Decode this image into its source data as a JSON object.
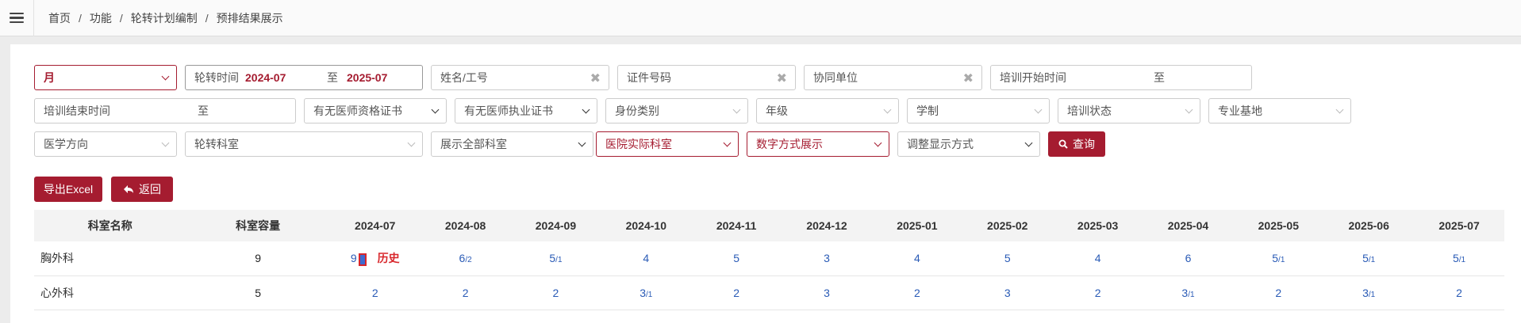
{
  "breadcrumb": [
    "首页",
    "功能",
    "轮转计划编制",
    "预排结果展示"
  ],
  "filters": {
    "period": "月",
    "rotation_time_label": "轮转时间",
    "rotation_start": "2024-07",
    "rotation_to": "至",
    "rotation_end": "2025-07",
    "name_placeholder": "姓名/工号",
    "id_placeholder": "证件号码",
    "coop_placeholder": "协同单位",
    "train_start_label": "培训开始时间",
    "train_start_to": "至",
    "train_end_label": "培训结束时间",
    "train_end_to": "至",
    "doctor_qual": "有无医师资格证书",
    "doctor_license": "有无医师执业证书",
    "identity": "身份类别",
    "grade": "年级",
    "schooling": "学制",
    "train_status": "培训状态",
    "base": "专业基地",
    "direction": "医学方向",
    "rotation_dept": "轮转科室",
    "show_all": "展示全部科室",
    "actual_dept": "医院实际科室",
    "display_mode": "数字方式展示",
    "adjust_mode": "调整显示方式",
    "query": "查询"
  },
  "actions": {
    "export": "导出Excel",
    "back": "返回"
  },
  "table": {
    "headers": [
      "科室名称",
      "科室容量",
      "2024-07",
      "2024-08",
      "2024-09",
      "2024-10",
      "2024-11",
      "2024-12",
      "2025-01",
      "2025-02",
      "2025-03",
      "2025-04",
      "2025-05",
      "2025-06",
      "2025-07"
    ],
    "rows": [
      {
        "name": "胸外科",
        "capacity": "9",
        "cells": [
          {
            "main": "9",
            "sub": ""
          },
          {
            "main": "6",
            "sub": "/2"
          },
          {
            "main": "5",
            "sub": "/1"
          },
          {
            "main": "4",
            "sub": ""
          },
          {
            "main": "5",
            "sub": ""
          },
          {
            "main": "3",
            "sub": ""
          },
          {
            "main": "4",
            "sub": ""
          },
          {
            "main": "5",
            "sub": ""
          },
          {
            "main": "4",
            "sub": ""
          },
          {
            "main": "6",
            "sub": ""
          },
          {
            "main": "5",
            "sub": "/1"
          },
          {
            "main": "5",
            "sub": "/1"
          },
          {
            "main": "5",
            "sub": "/1"
          }
        ],
        "history_label": "历史"
      },
      {
        "name": "心外科",
        "capacity": "5",
        "cells": [
          {
            "main": "2",
            "sub": ""
          },
          {
            "main": "2",
            "sub": ""
          },
          {
            "main": "2",
            "sub": ""
          },
          {
            "main": "3",
            "sub": "/1"
          },
          {
            "main": "2",
            "sub": ""
          },
          {
            "main": "3",
            "sub": ""
          },
          {
            "main": "2",
            "sub": ""
          },
          {
            "main": "3",
            "sub": ""
          },
          {
            "main": "2",
            "sub": ""
          },
          {
            "main": "3",
            "sub": "/1"
          },
          {
            "main": "2",
            "sub": ""
          },
          {
            "main": "3",
            "sub": "/1"
          },
          {
            "main": "2",
            "sub": ""
          }
        ]
      }
    ]
  }
}
